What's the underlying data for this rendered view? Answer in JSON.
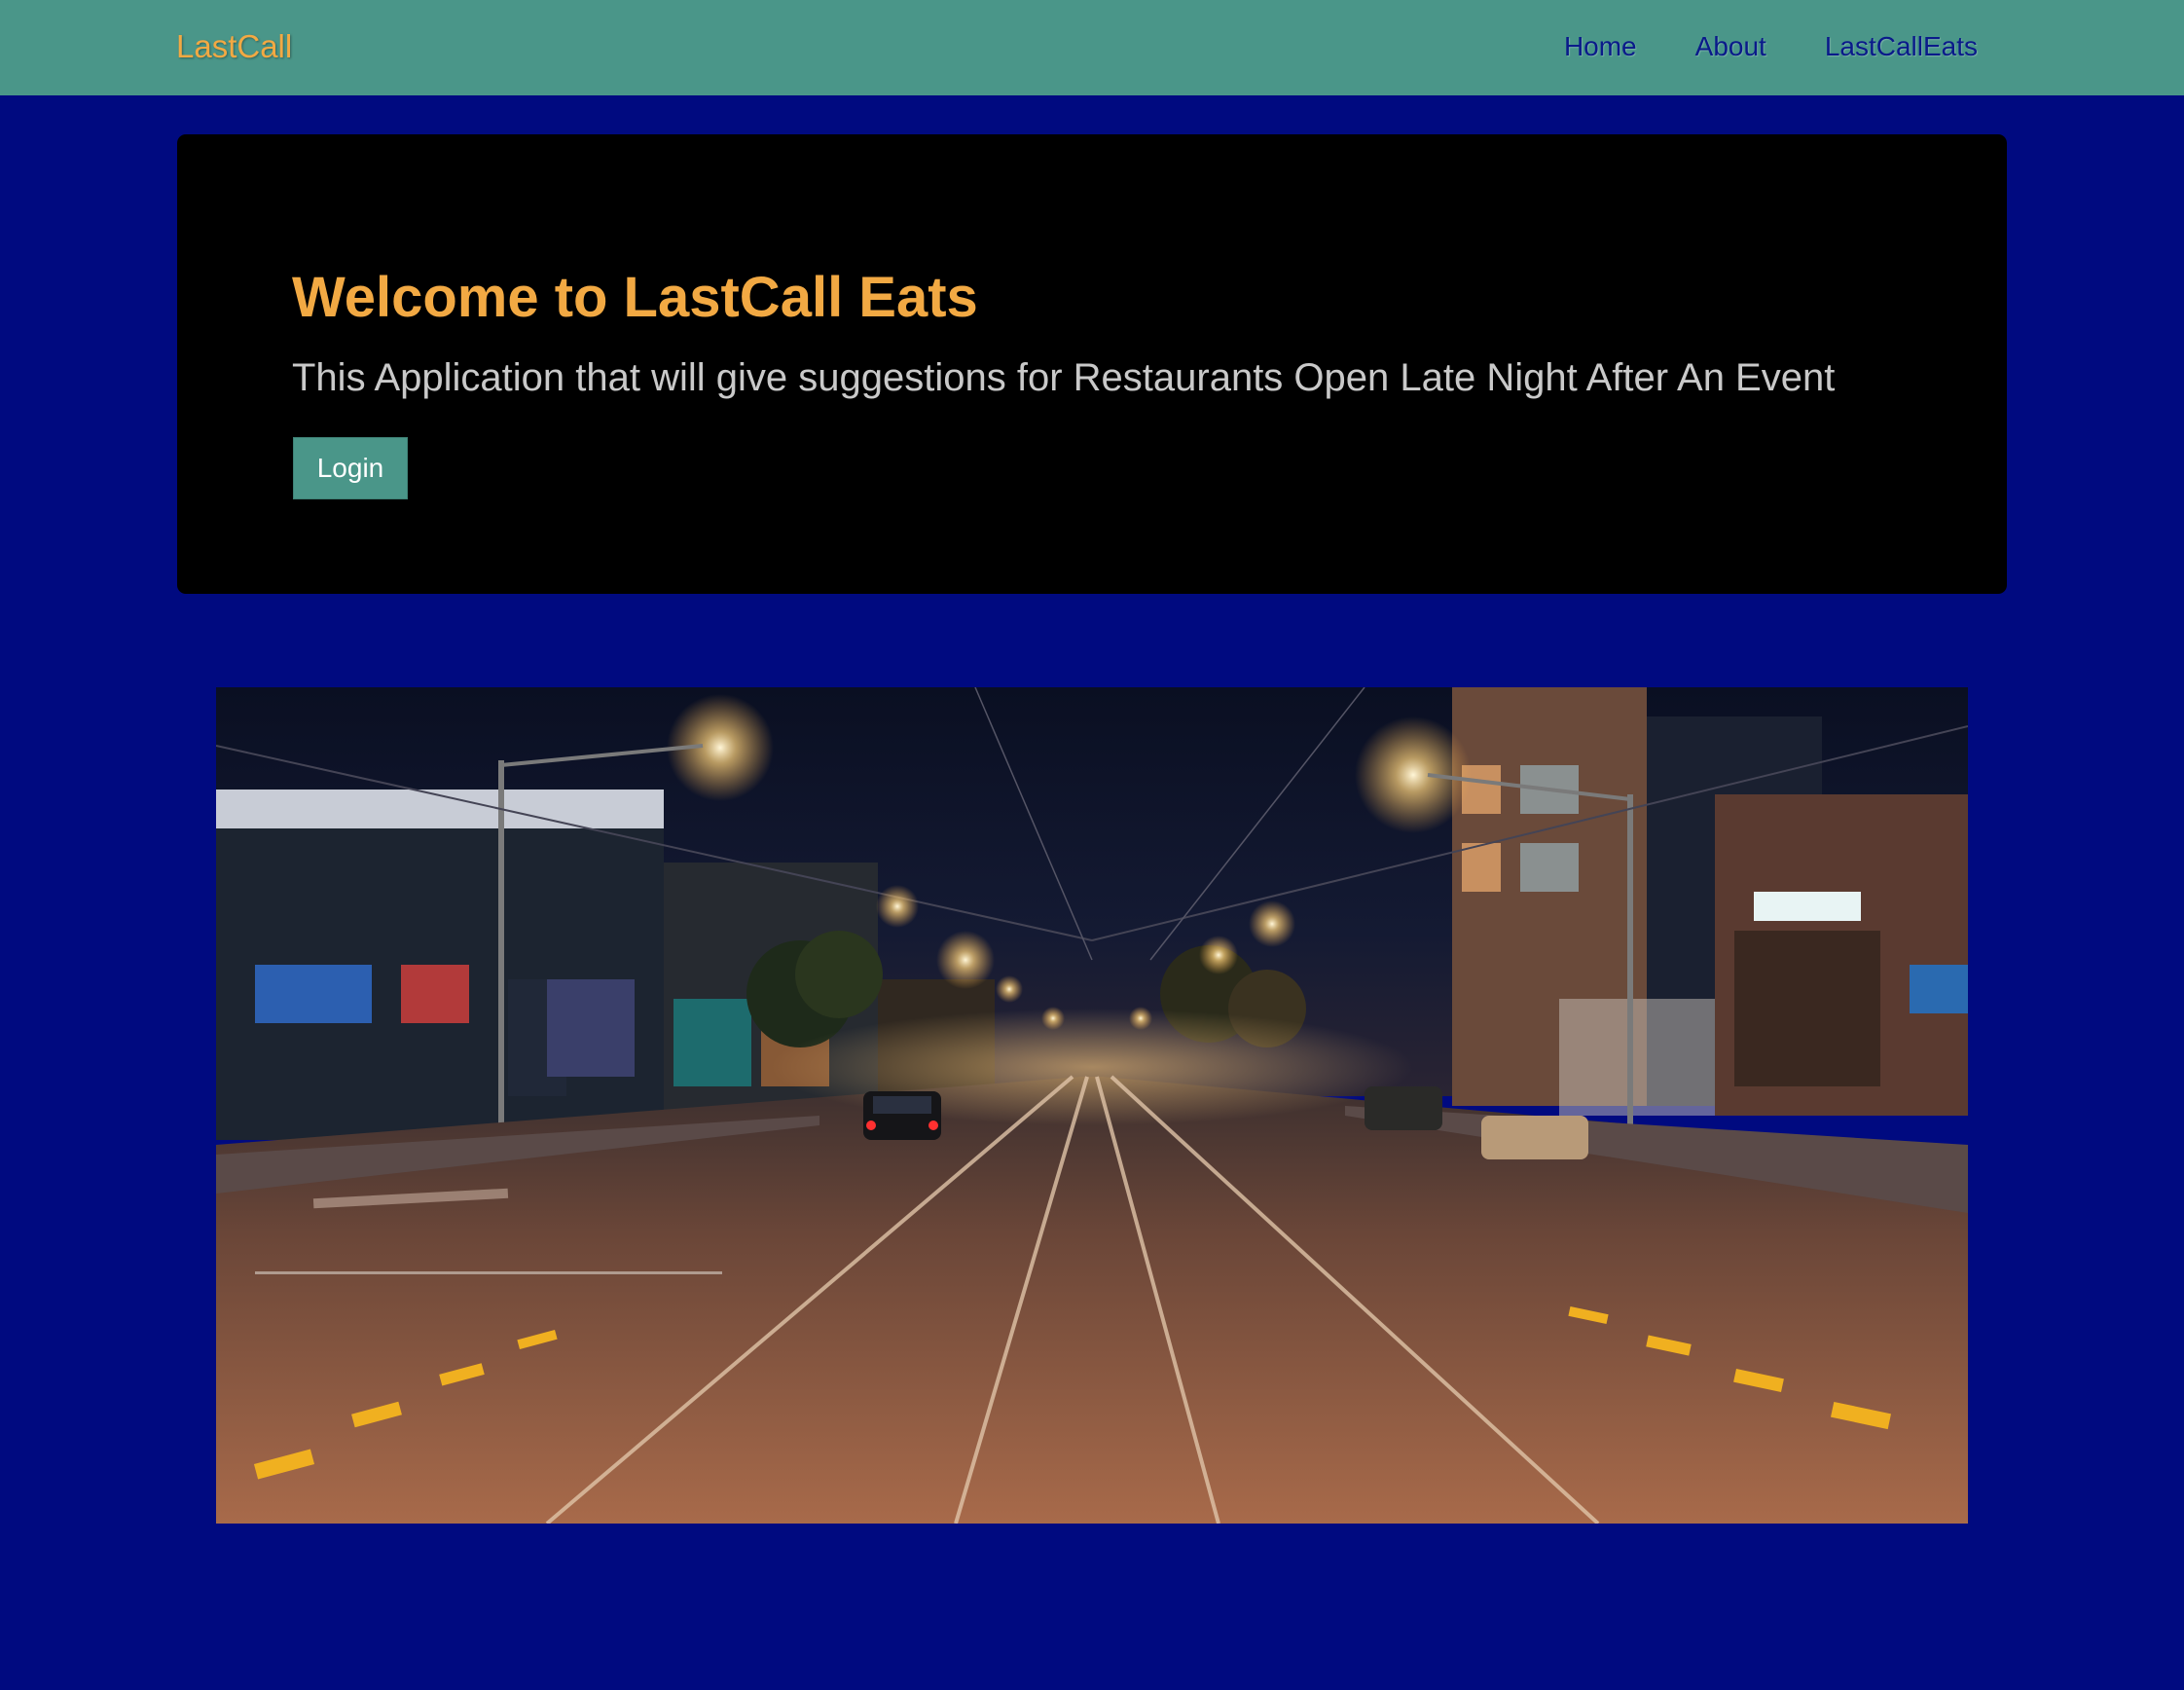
{
  "navbar": {
    "brand": "LastCall",
    "links": [
      "Home",
      "About",
      "LastCallEats"
    ]
  },
  "jumbotron": {
    "title": "Welcome to LastCall Eats",
    "lead": "This Application that will give suggestions for Restaurants Open Late Night After An Event",
    "login_label": "Login"
  },
  "hero_image": {
    "subject": "night city street with tram tracks and streetlights"
  },
  "colors": {
    "background": "#000a80",
    "navbar": "#4a9689",
    "accent": "#f2a943",
    "jumbotron": "#000000",
    "nav_link": "#0a1a8a"
  }
}
